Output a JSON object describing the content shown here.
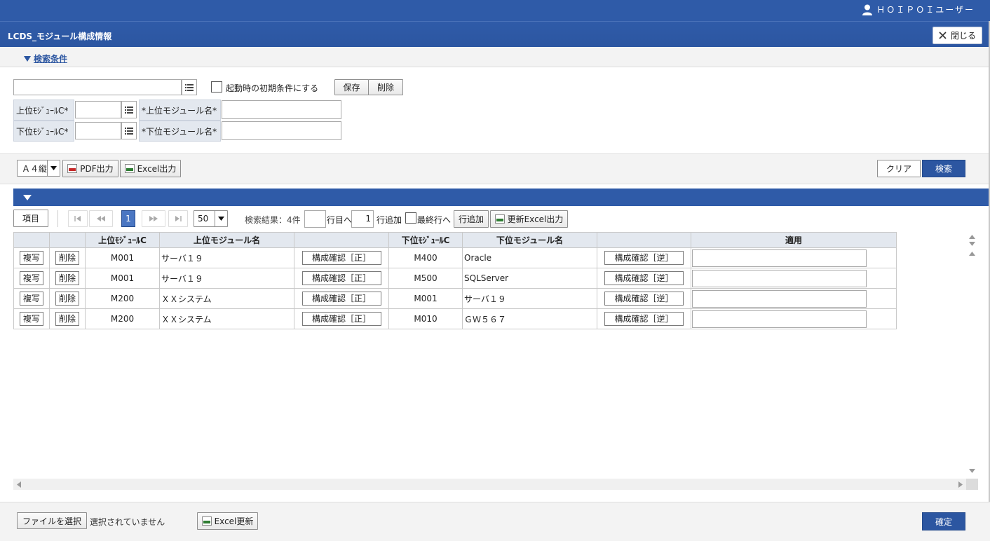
{
  "header": {
    "user": "ＨＯＩＰＯＩユーザー",
    "title": "LCDS_モジュール構成情報",
    "close_label": "閉じる"
  },
  "search": {
    "toggle_label": "検索条件",
    "init_condition_label": "起動時の初期条件にする",
    "save_label": "保存",
    "delete_label": "削除",
    "upper_code_label": "上位ﾓｼﾞｭｰﾙC*",
    "upper_name_label": "*上位モジュール名*",
    "lower_code_label": "下位ﾓｼﾞｭｰﾙC*",
    "lower_name_label": "*下位モジュール名*"
  },
  "output": {
    "paper_value": "Ａ４縦",
    "pdf_label": "PDF出力",
    "excel_label": "Excel出力",
    "clear_label": "クリア",
    "search_label": "検索"
  },
  "pager": {
    "items_label": "項目",
    "current_page": "1",
    "page_size": "50",
    "result_text": "検索結果：4件",
    "goto_value": "",
    "goto_suffix": "行目へ",
    "add_count": "1",
    "add_suffix": "行追加",
    "last_row_label": "最終行へ",
    "add_row_label": "行追加",
    "update_excel_label": "更新Excel出力"
  },
  "grid": {
    "headers": [
      "",
      "",
      "上位ﾓｼﾞｭｰﾙC",
      "上位モジュール名",
      "",
      "下位ﾓｼﾞｭｰﾙC",
      "下位モジュール名",
      "",
      "適用"
    ],
    "copy_label": "複写",
    "delete_label": "削除",
    "confirm_fwd_label": "構成確認［正］",
    "confirm_rev_label": "構成確認［逆］",
    "rows": [
      {
        "upper_code": "M001",
        "upper_name": "サーバ１９",
        "lower_code": "M400",
        "lower_name": "Oracle",
        "apply": ""
      },
      {
        "upper_code": "M001",
        "upper_name": "サーバ１９",
        "lower_code": "M500",
        "lower_name": "SQLServer",
        "apply": ""
      },
      {
        "upper_code": "M200",
        "upper_name": "ＸＸシステム",
        "lower_code": "M001",
        "lower_name": "サーバ１９",
        "apply": ""
      },
      {
        "upper_code": "M200",
        "upper_name": "ＸＸシステム",
        "lower_code": "M010",
        "lower_name": "ＧＷ５６７",
        "apply": ""
      }
    ]
  },
  "footer": {
    "file_select_label": "ファイルを選択",
    "file_status": "選択されていません",
    "excel_update_label": "Excel更新",
    "confirm_label": "確定"
  },
  "colors": {
    "primary": "#2f5ba8",
    "label_bg": "#e3e8ef"
  }
}
